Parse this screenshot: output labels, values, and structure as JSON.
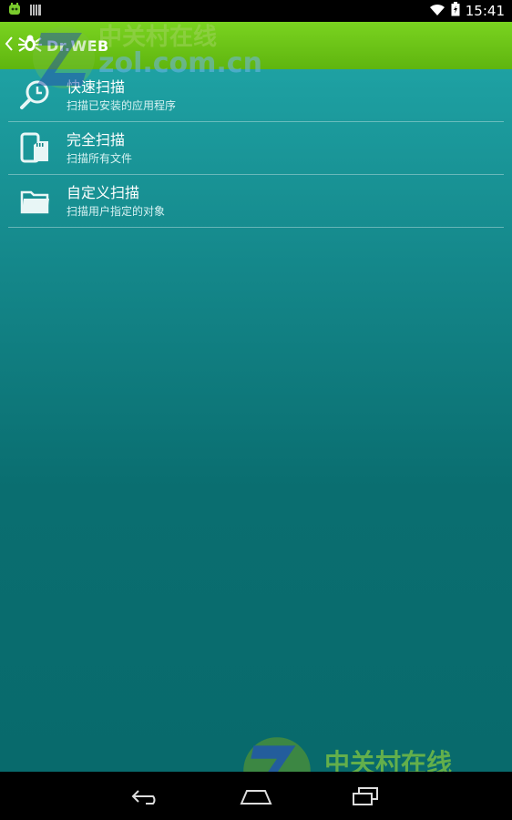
{
  "status_bar": {
    "time": "15:41"
  },
  "action_bar": {
    "title": "Dr.WEB"
  },
  "menu": {
    "items": [
      {
        "title": "快速扫描",
        "subtitle": "扫描已安装的应用程序",
        "icon": "clock-search-icon"
      },
      {
        "title": "完全扫描",
        "subtitle": "扫描所有文件",
        "icon": "device-sdcard-icon"
      },
      {
        "title": "自定义扫描",
        "subtitle": "扫描用户指定的对象",
        "icon": "folder-icon"
      }
    ]
  },
  "watermark": {
    "cn": "中关村在线",
    "domain": "zol.com.cn"
  },
  "colors": {
    "action_bar": "#6cc417",
    "content_top": "#1ea1a3",
    "content_bottom": "#086a6c"
  }
}
